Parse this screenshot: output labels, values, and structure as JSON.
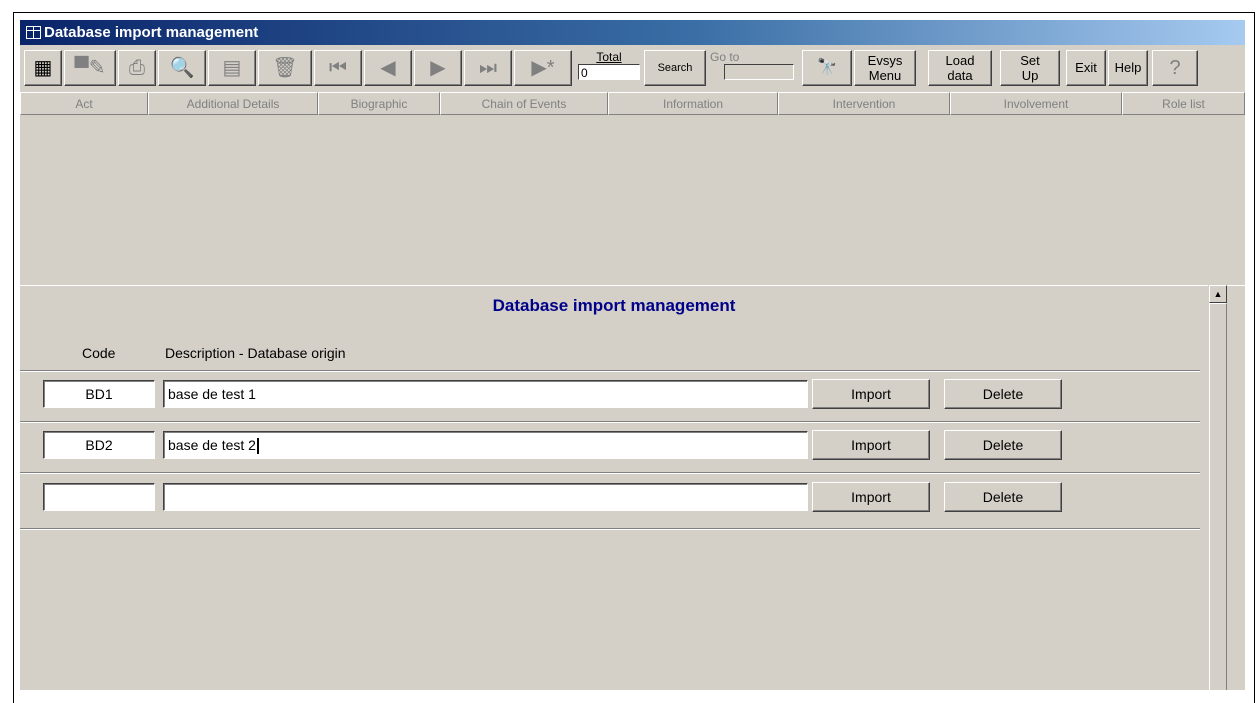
{
  "window": {
    "title": "Database import management"
  },
  "toolbar": {
    "icons": [
      "datasheet-view-icon",
      "save-record-icon",
      "print-icon",
      "print-preview-icon",
      "form-view-icon",
      "delete-record-icon",
      "first-record-icon",
      "previous-record-icon",
      "next-record-icon",
      "last-record-icon",
      "new-record-icon"
    ],
    "total_label": "Total",
    "total_value": "0",
    "search_label": "Search",
    "goto_label": "Go to",
    "goto_value": "",
    "evsys_menu_line1": "Evsys",
    "evsys_menu_line2": "Menu",
    "load_data_line1": "Load",
    "load_data_line2": "data",
    "setup_line1": "Set",
    "setup_line2": "Up",
    "exit_label": "Exit",
    "help_label": "Help",
    "help_icon": "?"
  },
  "tabs": [
    "Act",
    "Additional Details",
    "Biographic",
    "Chain of Events",
    "Information",
    "Intervention",
    "Involvement",
    "Role list"
  ],
  "form": {
    "title": "Database import management",
    "code_header": "Code",
    "description_header": "Description - Database origin",
    "import_label": "Import",
    "delete_label": "Delete",
    "rows": [
      {
        "code": "BD1",
        "description": "base de test 1"
      },
      {
        "code": "BD2",
        "description": "base de test 2"
      },
      {
        "code": "",
        "description": ""
      }
    ]
  }
}
